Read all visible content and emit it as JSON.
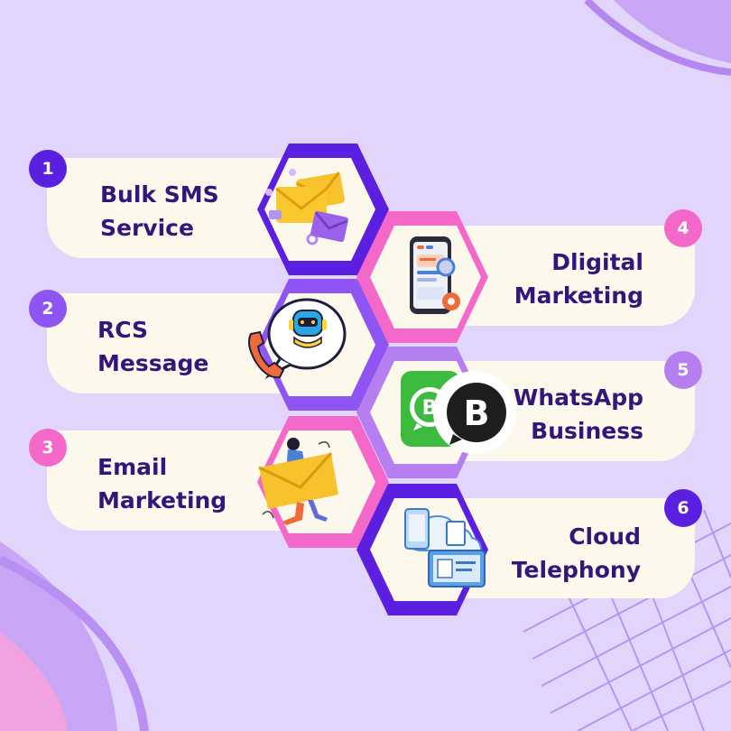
{
  "colors": {
    "background": "#e2d5fb",
    "card": "#fdf8ec",
    "text": "#34157a",
    "purple_dark": "#5b1fe0",
    "purple_mid": "#8f55f2",
    "purple_light": "#b57ff0",
    "pink": "#f368c8"
  },
  "items": [
    {
      "number": "1",
      "line1": "Bulk SMS",
      "line2": "Service",
      "icon": "envelopes-icon"
    },
    {
      "number": "2",
      "line1": "RCS",
      "line2": "Message",
      "icon": "chatbot-phone-icon"
    },
    {
      "number": "3",
      "line1": "Email",
      "line2": "Marketing",
      "icon": "email-marketing-icon"
    },
    {
      "number": "4",
      "line1": "Dligital",
      "line2": "Marketing",
      "icon": "smartphone-analytics-icon"
    },
    {
      "number": "5",
      "line1": "WhatsApp",
      "line2": "Business",
      "icon": "whatsapp-business-icon"
    },
    {
      "number": "6",
      "line1": "Cloud",
      "line2": "Telephony",
      "icon": "cloud-devices-icon"
    }
  ]
}
